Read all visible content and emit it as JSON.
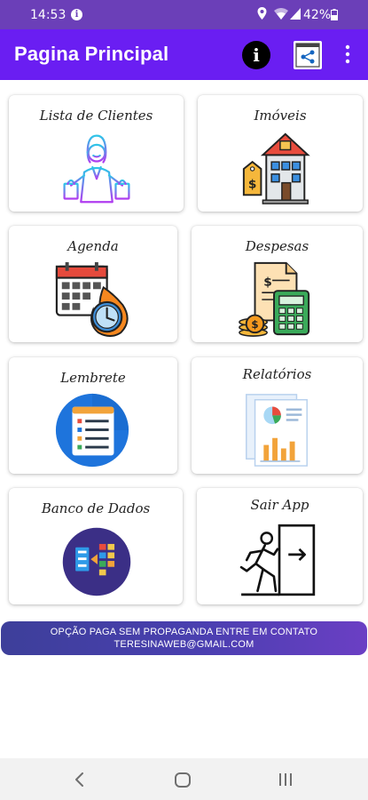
{
  "status_bar": {
    "time": "14:53",
    "battery_pct": "42%",
    "icons": [
      "notification-icon",
      "location-icon",
      "wifi-icon",
      "signal-icon",
      "battery-icon"
    ]
  },
  "app_bar": {
    "title": "Pagina Principal",
    "info_glyph": "i",
    "background": "#6a1ef2"
  },
  "cards": [
    {
      "label": "Lista de Clientes",
      "icon": "customer-shopping-icon"
    },
    {
      "label": "Imóveis",
      "icon": "building-price-icon"
    },
    {
      "label": "Agenda",
      "icon": "calendar-clock-icon"
    },
    {
      "label": "Despesas",
      "icon": "bill-calculator-icon"
    },
    {
      "label": "Lembrete",
      "icon": "checklist-icon"
    },
    {
      "label": "Relatórios",
      "icon": "report-chart-icon"
    },
    {
      "label": "Banco de Dados",
      "icon": "database-transfer-icon"
    },
    {
      "label": "Sair App",
      "icon": "exit-running-icon"
    }
  ],
  "banner": {
    "line1": "OPÇÃO PAGA  SEM PROPAGANDA ENTRE EM CONTATO",
    "line2": "TERESINAWEB@GMAIL.COM"
  },
  "nav_bar": {
    "icons": [
      "back-icon",
      "home-icon",
      "recents-icon"
    ]
  }
}
